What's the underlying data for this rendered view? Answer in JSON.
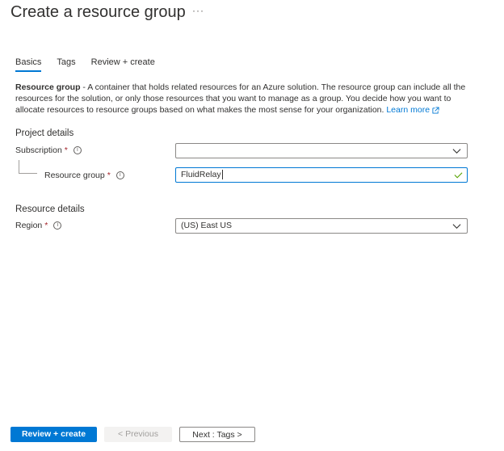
{
  "header": {
    "title": "Create a resource group",
    "more_label": "···"
  },
  "tabs": [
    {
      "label": "Basics",
      "active": true
    },
    {
      "label": "Tags",
      "active": false
    },
    {
      "label": "Review + create",
      "active": false
    }
  ],
  "description": {
    "bold": "Resource group",
    "text": " - A container that holds related resources for an Azure solution. The resource group can include all the resources for the solution, or only those resources that you want to manage as a group. You decide how you want to allocate resources to resource groups based on what makes the most sense for your organization. ",
    "link": "Learn more",
    "link_icon": "external-link-icon"
  },
  "project_details": {
    "heading": "Project details",
    "subscription": {
      "label": "Subscription",
      "required": "*",
      "value": ""
    },
    "resource_group": {
      "label": "Resource group",
      "required": "*",
      "value": "FluidRelay",
      "valid": true
    }
  },
  "resource_details": {
    "heading": "Resource details",
    "region": {
      "label": "Region",
      "required": "*",
      "value": "(US) East US"
    }
  },
  "footer": {
    "review_create": "Review + create",
    "previous": "< Previous",
    "next": "Next : Tags >"
  },
  "colors": {
    "accent": "#0078d4",
    "required": "#a4262c",
    "valid": "#57a300"
  }
}
